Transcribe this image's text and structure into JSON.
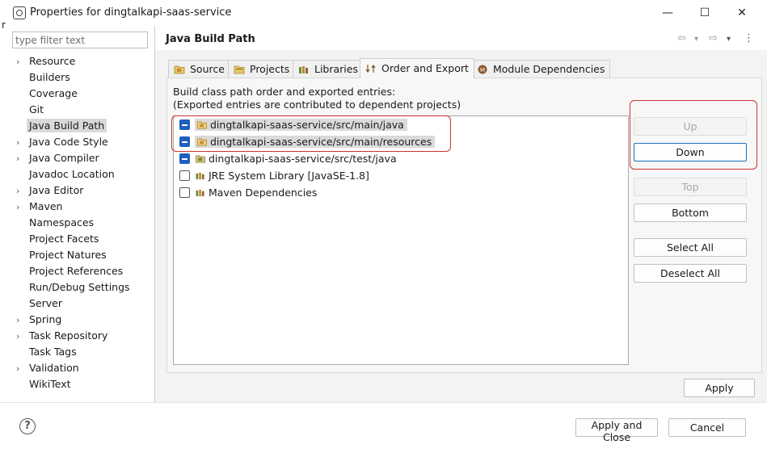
{
  "window": {
    "title": "Properties for dingtalkapi-saas-service",
    "minimize_glyph": "—",
    "maximize_glyph": "☐",
    "close_glyph": "✕",
    "stray_char": "r"
  },
  "filter": {
    "placeholder": "type filter text",
    "value": ""
  },
  "sidebar": {
    "items": [
      {
        "label": "Resource",
        "expandable": true
      },
      {
        "label": "Builders",
        "expandable": false
      },
      {
        "label": "Coverage",
        "expandable": false
      },
      {
        "label": "Git",
        "expandable": false
      },
      {
        "label": "Java Build Path",
        "expandable": false,
        "selected": true
      },
      {
        "label": "Java Code Style",
        "expandable": true
      },
      {
        "label": "Java Compiler",
        "expandable": true
      },
      {
        "label": "Javadoc Location",
        "expandable": false
      },
      {
        "label": "Java Editor",
        "expandable": true
      },
      {
        "label": "Maven",
        "expandable": true
      },
      {
        "label": "Namespaces",
        "expandable": false
      },
      {
        "label": "Project Facets",
        "expandable": false
      },
      {
        "label": "Project Natures",
        "expandable": false
      },
      {
        "label": "Project References",
        "expandable": false
      },
      {
        "label": "Run/Debug Settings",
        "expandable": false
      },
      {
        "label": "Server",
        "expandable": false
      },
      {
        "label": "Spring",
        "expandable": true
      },
      {
        "label": "Task Repository",
        "expandable": true
      },
      {
        "label": "Task Tags",
        "expandable": false
      },
      {
        "label": "Validation",
        "expandable": true
      },
      {
        "label": "WikiText",
        "expandable": false
      }
    ]
  },
  "page": {
    "title": "Java Build Path",
    "nav": {
      "back": "⇦",
      "back_menu": "▾",
      "forward": "⇨",
      "forward_menu": "▾",
      "menu": "⋮"
    }
  },
  "tabs": [
    {
      "label": "Source",
      "icon": "source-folder-icon"
    },
    {
      "label": "Projects",
      "icon": "projects-icon"
    },
    {
      "label": "Libraries",
      "icon": "libraries-icon"
    },
    {
      "label": "Order and Export",
      "icon": "order-export-icon",
      "active": true
    },
    {
      "label": "Module Dependencies",
      "icon": "module-icon"
    }
  ],
  "order_export": {
    "description_line1": "Build class path order and exported entries:",
    "description_line2": "(Exported entries are contributed to dependent projects)",
    "entries": [
      {
        "label": "dingtalkapi-saas-service/src/main/java",
        "checked": true,
        "highlighted": true,
        "icon": "source-folder-icon"
      },
      {
        "label": "dingtalkapi-saas-service/src/main/resources",
        "checked": true,
        "highlighted": true,
        "icon": "source-folder-icon"
      },
      {
        "label": "dingtalkapi-saas-service/src/test/java",
        "checked": true,
        "highlighted": false,
        "icon": "test-source-folder-icon"
      },
      {
        "label": "JRE System Library [JavaSE-1.8]",
        "checked": false,
        "highlighted": false,
        "icon": "library-icon"
      },
      {
        "label": "Maven Dependencies",
        "checked": false,
        "highlighted": false,
        "icon": "library-icon"
      }
    ],
    "buttons": {
      "up": "Up",
      "down": "Down",
      "top": "Top",
      "bottom": "Bottom",
      "select_all": "Select All",
      "deselect_all": "Deselect All"
    }
  },
  "footer": {
    "apply": "Apply",
    "apply_and_close": "Apply and Close",
    "cancel": "Cancel",
    "help": "?"
  },
  "colors": {
    "accent": "#1e5fbf",
    "annotation_red": "#c9342f",
    "focus_border": "#1a73c6"
  }
}
